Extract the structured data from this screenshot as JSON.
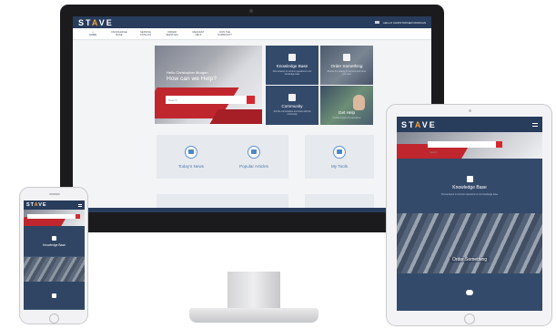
{
  "site": {
    "logo": {
      "pre": "ST",
      "mid": "A",
      "post": "VE"
    },
    "user_label": "HELLO CHRISTOPHER MORGAN",
    "nav": [
      {
        "label": "HOME",
        "icon": "home-icon"
      },
      {
        "label": "KNOWLEDGE BASE",
        "icon": ""
      },
      {
        "label": "SERVICE CATALOG",
        "icon": ""
      },
      {
        "label": "ORDER SERVICES",
        "icon": ""
      },
      {
        "label": "REQUEST HELP",
        "icon": ""
      },
      {
        "label": "JOIN THE COMMUNITY",
        "icon": ""
      }
    ],
    "hero": {
      "greeting": "Hello Christopher Morgan",
      "headline": "How can we Help?",
      "search_placeholder": "Search"
    },
    "tiles": {
      "knowledge_base": {
        "title": "Knowledge Base",
        "subtitle": "Find answers to common questions in our knowledge base"
      },
      "order_something": {
        "title": "Order Something",
        "subtitle": "Browse the catalog for services and items you need"
      },
      "community": {
        "title": "Community",
        "subtitle": "Join the conversation and share with the community"
      },
      "get_help": {
        "title": "Get Help",
        "subtitle": "Contact support for assistance"
      }
    },
    "cards": [
      {
        "label": "Today's News",
        "icon": "newspaper-icon"
      },
      {
        "label": "Popular Articles",
        "icon": "article-icon"
      },
      {
        "label": "My Tools",
        "icon": "tools-icon"
      },
      {
        "label": "",
        "icon": "checklist-icon"
      },
      {
        "label": "",
        "icon": "share-icon"
      },
      {
        "label": "",
        "icon": "search-icon"
      }
    ],
    "footer_text": "Service Portal powered by ServiceNow"
  },
  "phone": {
    "tile_title": "Knowledge Base"
  },
  "tablet": {
    "search_placeholder": "Search",
    "kb_title": "Knowledge Base",
    "kb_subtitle": "Find answers to common questions in our knowledge base",
    "order_title": "Order Something"
  },
  "colors": {
    "header_navy": "#283c5c",
    "tile_navy": "#344a6b",
    "accent_red": "#d5292f",
    "logo_orange": "#f4a23c",
    "card_blue": "#4a79b0"
  }
}
